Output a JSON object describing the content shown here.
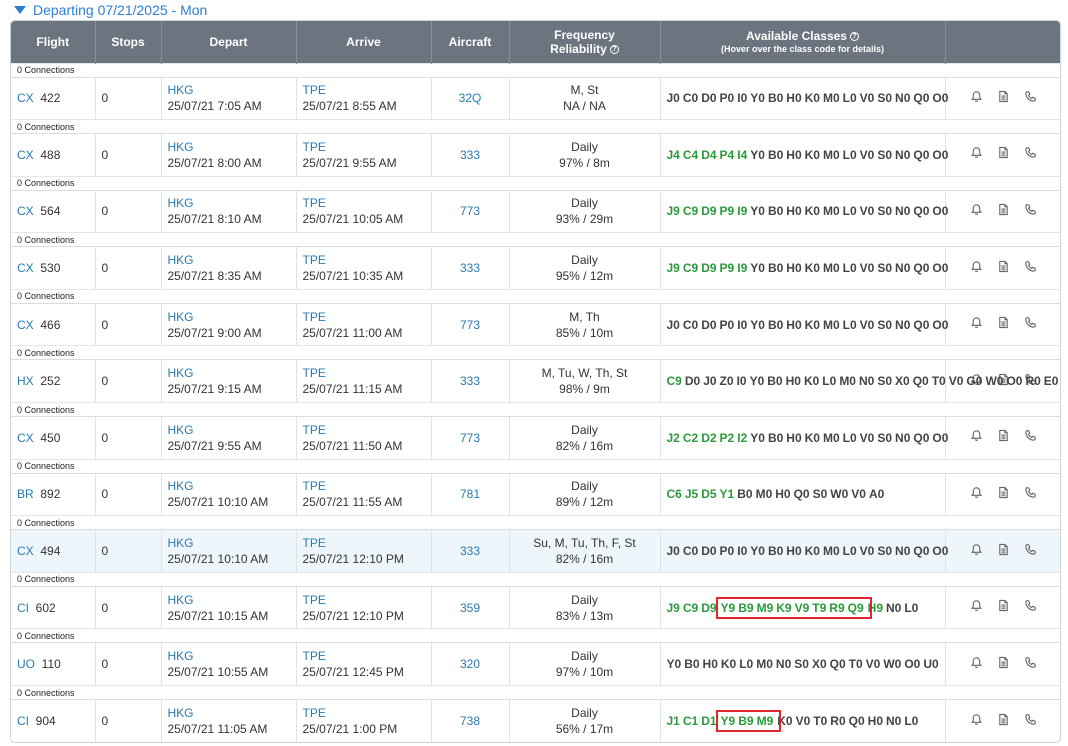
{
  "header": {
    "departing": "Departing 07/21/2025 - Mon"
  },
  "columns": {
    "flight": "Flight",
    "stops": "Stops",
    "depart": "Depart",
    "arrive": "Arrive",
    "aircraft": "Aircraft",
    "frequency": "Frequency",
    "reliability": "Reliability",
    "classes": "Available Classes",
    "classes_sub": "(Hover over the class code for details)"
  },
  "flights": [
    {
      "connections": "0 Connections",
      "airline": "CX",
      "number": "422",
      "stops": "0",
      "dep_airport": "HKG",
      "dep_time": "25/07/21 7:05 AM",
      "arr_airport": "TPE",
      "arr_time": "25/07/21 8:55 AM",
      "aircraft": "32Q",
      "frequency": "M, St",
      "reliability": "NA / NA",
      "classes": [
        [
          "J0",
          0
        ],
        [
          "C0",
          0
        ],
        [
          "D0",
          0
        ],
        [
          "P0",
          0
        ],
        [
          "I0",
          0
        ],
        [
          "Y0",
          0
        ],
        [
          "B0",
          0
        ],
        [
          "H0",
          0
        ],
        [
          "K0",
          0
        ],
        [
          "M0",
          0
        ],
        [
          "L0",
          0
        ],
        [
          "V0",
          0
        ],
        [
          "S0",
          0
        ],
        [
          "N0",
          0
        ],
        [
          "Q0",
          0
        ],
        [
          "O0",
          0
        ]
      ]
    },
    {
      "connections": "0 Connections",
      "airline": "CX",
      "number": "488",
      "stops": "0",
      "dep_airport": "HKG",
      "dep_time": "25/07/21 8:00 AM",
      "arr_airport": "TPE",
      "arr_time": "25/07/21 9:55 AM",
      "aircraft": "333",
      "frequency": "Daily",
      "reliability": "97% / 8m",
      "classes": [
        [
          "J4",
          1
        ],
        [
          "C4",
          1
        ],
        [
          "D4",
          1
        ],
        [
          "P4",
          1
        ],
        [
          "I4",
          1
        ],
        [
          "Y0",
          0
        ],
        [
          "B0",
          0
        ],
        [
          "H0",
          0
        ],
        [
          "K0",
          0
        ],
        [
          "M0",
          0
        ],
        [
          "L0",
          0
        ],
        [
          "V0",
          0
        ],
        [
          "S0",
          0
        ],
        [
          "N0",
          0
        ],
        [
          "Q0",
          0
        ],
        [
          "O0",
          0
        ]
      ]
    },
    {
      "connections": "0 Connections",
      "airline": "CX",
      "number": "564",
      "stops": "0",
      "dep_airport": "HKG",
      "dep_time": "25/07/21 8:10 AM",
      "arr_airport": "TPE",
      "arr_time": "25/07/21 10:05 AM",
      "aircraft": "773",
      "frequency": "Daily",
      "reliability": "93% / 29m",
      "classes": [
        [
          "J9",
          1
        ],
        [
          "C9",
          1
        ],
        [
          "D9",
          1
        ],
        [
          "P9",
          1
        ],
        [
          "I9",
          1
        ],
        [
          "Y0",
          0
        ],
        [
          "B0",
          0
        ],
        [
          "H0",
          0
        ],
        [
          "K0",
          0
        ],
        [
          "M0",
          0
        ],
        [
          "L0",
          0
        ],
        [
          "V0",
          0
        ],
        [
          "S0",
          0
        ],
        [
          "N0",
          0
        ],
        [
          "Q0",
          0
        ],
        [
          "O0",
          0
        ]
      ]
    },
    {
      "connections": "0 Connections",
      "airline": "CX",
      "number": "530",
      "stops": "0",
      "dep_airport": "HKG",
      "dep_time": "25/07/21 8:35 AM",
      "arr_airport": "TPE",
      "arr_time": "25/07/21 10:35 AM",
      "aircraft": "333",
      "frequency": "Daily",
      "reliability": "95% / 12m",
      "classes": [
        [
          "J9",
          1
        ],
        [
          "C9",
          1
        ],
        [
          "D9",
          1
        ],
        [
          "P9",
          1
        ],
        [
          "I9",
          1
        ],
        [
          "Y0",
          0
        ],
        [
          "B0",
          0
        ],
        [
          "H0",
          0
        ],
        [
          "K0",
          0
        ],
        [
          "M0",
          0
        ],
        [
          "L0",
          0
        ],
        [
          "V0",
          0
        ],
        [
          "S0",
          0
        ],
        [
          "N0",
          0
        ],
        [
          "Q0",
          0
        ],
        [
          "O0",
          0
        ]
      ]
    },
    {
      "connections": "0 Connections",
      "airline": "CX",
      "number": "466",
      "stops": "0",
      "dep_airport": "HKG",
      "dep_time": "25/07/21 9:00 AM",
      "arr_airport": "TPE",
      "arr_time": "25/07/21 11:00 AM",
      "aircraft": "773",
      "frequency": "M, Th",
      "reliability": "85% / 10m",
      "classes": [
        [
          "J0",
          0
        ],
        [
          "C0",
          0
        ],
        [
          "D0",
          0
        ],
        [
          "P0",
          0
        ],
        [
          "I0",
          0
        ],
        [
          "Y0",
          0
        ],
        [
          "B0",
          0
        ],
        [
          "H0",
          0
        ],
        [
          "K0",
          0
        ],
        [
          "M0",
          0
        ],
        [
          "L0",
          0
        ],
        [
          "V0",
          0
        ],
        [
          "S0",
          0
        ],
        [
          "N0",
          0
        ],
        [
          "Q0",
          0
        ],
        [
          "O0",
          0
        ]
      ]
    },
    {
      "connections": "0 Connections",
      "airline": "HX",
      "number": "252",
      "stops": "0",
      "dep_airport": "HKG",
      "dep_time": "25/07/21 9:15 AM",
      "arr_airport": "TPE",
      "arr_time": "25/07/21 11:15 AM",
      "aircraft": "333",
      "frequency": "M, Tu, W, Th, St",
      "reliability": "98% / 9m",
      "classes": [
        [
          "C9",
          1
        ],
        [
          "D0",
          0
        ],
        [
          "J0",
          0
        ],
        [
          "Z0",
          0
        ],
        [
          "I0",
          0
        ],
        [
          "Y0",
          0
        ],
        [
          "B0",
          0
        ],
        [
          "H0",
          0
        ],
        [
          "K0",
          0
        ],
        [
          "L0",
          0
        ],
        [
          "M0",
          0
        ],
        [
          "N0",
          0
        ],
        [
          "S0",
          0
        ],
        [
          "X0",
          0
        ],
        [
          "Q0",
          0
        ],
        [
          "T0",
          0
        ],
        [
          "V0",
          0
        ],
        [
          "G0",
          0
        ],
        [
          "W0",
          0
        ],
        [
          "O0",
          0
        ],
        [
          "R0",
          0
        ],
        [
          "E0",
          0
        ]
      ]
    },
    {
      "connections": "0 Connections",
      "airline": "CX",
      "number": "450",
      "stops": "0",
      "dep_airport": "HKG",
      "dep_time": "25/07/21 9:55 AM",
      "arr_airport": "TPE",
      "arr_time": "25/07/21 11:50 AM",
      "aircraft": "773",
      "frequency": "Daily",
      "reliability": "82% / 16m",
      "classes": [
        [
          "J2",
          1
        ],
        [
          "C2",
          1
        ],
        [
          "D2",
          1
        ],
        [
          "P2",
          1
        ],
        [
          "I2",
          1
        ],
        [
          "Y0",
          0
        ],
        [
          "B0",
          0
        ],
        [
          "H0",
          0
        ],
        [
          "K0",
          0
        ],
        [
          "M0",
          0
        ],
        [
          "L0",
          0
        ],
        [
          "V0",
          0
        ],
        [
          "S0",
          0
        ],
        [
          "N0",
          0
        ],
        [
          "Q0",
          0
        ],
        [
          "O0",
          0
        ]
      ]
    },
    {
      "connections": "0 Connections",
      "airline": "BR",
      "number": "892",
      "stops": "0",
      "dep_airport": "HKG",
      "dep_time": "25/07/21 10:10 AM",
      "arr_airport": "TPE",
      "arr_time": "25/07/21 11:55 AM",
      "aircraft": "781",
      "frequency": "Daily",
      "reliability": "89% / 12m",
      "classes": [
        [
          "C6",
          1
        ],
        [
          "J5",
          1
        ],
        [
          "D5",
          1
        ],
        [
          "Y1",
          1
        ],
        [
          "B0",
          0
        ],
        [
          "M0",
          0
        ],
        [
          "H0",
          0
        ],
        [
          "Q0",
          0
        ],
        [
          "S0",
          0
        ],
        [
          "W0",
          0
        ],
        [
          "V0",
          0
        ],
        [
          "A0",
          0
        ]
      ]
    },
    {
      "connections": "0 Connections",
      "airline": "CX",
      "number": "494",
      "stops": "0",
      "dep_airport": "HKG",
      "dep_time": "25/07/21 10:10 AM",
      "arr_airport": "TPE",
      "arr_time": "25/07/21 12:10 PM",
      "aircraft": "333",
      "frequency": "Su, M, Tu, Th, F, St",
      "reliability": "82% / 16m",
      "highlight": true,
      "classes": [
        [
          "J0",
          0
        ],
        [
          "C0",
          0
        ],
        [
          "D0",
          0
        ],
        [
          "P0",
          0
        ],
        [
          "I0",
          0
        ],
        [
          "Y0",
          0
        ],
        [
          "B0",
          0
        ],
        [
          "H0",
          0
        ],
        [
          "K0",
          0
        ],
        [
          "M0",
          0
        ],
        [
          "L0",
          0
        ],
        [
          "V0",
          0
        ],
        [
          "S0",
          0
        ],
        [
          "N0",
          0
        ],
        [
          "Q0",
          0
        ],
        [
          "O0",
          0
        ]
      ]
    },
    {
      "connections": "0 Connections",
      "airline": "CI",
      "number": "602",
      "stops": "0",
      "dep_airport": "HKG",
      "dep_time": "25/07/21 10:15 AM",
      "arr_airport": "TPE",
      "arr_time": "25/07/21 12:10 PM",
      "aircraft": "359",
      "frequency": "Daily",
      "reliability": "83% / 13m",
      "boxed": [
        3,
        10
      ],
      "classes": [
        [
          "J9",
          1
        ],
        [
          "C9",
          1
        ],
        [
          "D9",
          1
        ],
        [
          "Y9",
          1
        ],
        [
          "B9",
          1
        ],
        [
          "M9",
          1
        ],
        [
          "K9",
          1
        ],
        [
          "V9",
          1
        ],
        [
          "T9",
          1
        ],
        [
          "R9",
          1
        ],
        [
          "Q9",
          1
        ],
        [
          "H9",
          1
        ],
        [
          "N0",
          0
        ],
        [
          "L0",
          0
        ]
      ]
    },
    {
      "connections": "0 Connections",
      "airline": "UO",
      "number": "110",
      "stops": "0",
      "dep_airport": "HKG",
      "dep_time": "25/07/21 10:55 AM",
      "arr_airport": "TPE",
      "arr_time": "25/07/21 12:45 PM",
      "aircraft": "320",
      "frequency": "Daily",
      "reliability": "97% / 10m",
      "classes": [
        [
          "Y0",
          0
        ],
        [
          "B0",
          0
        ],
        [
          "H0",
          0
        ],
        [
          "K0",
          0
        ],
        [
          "L0",
          0
        ],
        [
          "M0",
          0
        ],
        [
          "N0",
          0
        ],
        [
          "S0",
          0
        ],
        [
          "X0",
          0
        ],
        [
          "Q0",
          0
        ],
        [
          "T0",
          0
        ],
        [
          "V0",
          0
        ],
        [
          "W0",
          0
        ],
        [
          "O0",
          0
        ],
        [
          "U0",
          0
        ]
      ]
    },
    {
      "connections": "0 Connections",
      "airline": "CI",
      "number": "904",
      "stops": "0",
      "dep_airport": "HKG",
      "dep_time": "25/07/21 11:05 AM",
      "arr_airport": "TPE",
      "arr_time": "25/07/21 1:00 PM",
      "aircraft": "738",
      "frequency": "Daily",
      "reliability": "56% / 17m",
      "boxed": [
        3,
        5
      ],
      "classes": [
        [
          "J1",
          1
        ],
        [
          "C1",
          1
        ],
        [
          "D1",
          1
        ],
        [
          "Y9",
          1
        ],
        [
          "B9",
          1
        ],
        [
          "M9",
          1
        ],
        [
          "K0",
          0
        ],
        [
          "V0",
          0
        ],
        [
          "T0",
          0
        ],
        [
          "R0",
          0
        ],
        [
          "Q0",
          0
        ],
        [
          "H0",
          0
        ],
        [
          "N0",
          0
        ],
        [
          "L0",
          0
        ]
      ]
    }
  ]
}
